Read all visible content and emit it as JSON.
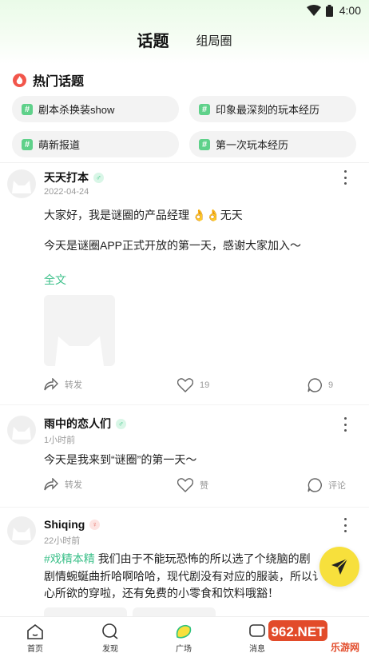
{
  "status_bar": {
    "time": "4:00",
    "icons": [
      "wifi-icon",
      "battery-icon"
    ]
  },
  "tabs": [
    {
      "label": "话题",
      "active": true
    },
    {
      "label": "组局圈",
      "active": false
    }
  ],
  "hot_topics": {
    "title": "热门话题",
    "icon": "fire-icon",
    "items": [
      {
        "label": "剧本杀换装show"
      },
      {
        "label": "印象最深刻的玩本经历"
      },
      {
        "label": "萌新报道"
      },
      {
        "label": "第一次玩本经历"
      }
    ]
  },
  "posts": [
    {
      "username": "天天打本",
      "gender": "♂",
      "time": "2022-04-24",
      "text_line1": "大家好，我是谜圈的产品经理 👌👌无天",
      "text_line2": "今天是谜圈APP正式开放的第一天，感谢大家加入～",
      "full_text": "全文",
      "forward_label": "转发",
      "likes": "19",
      "comments": "9"
    },
    {
      "username": "雨中的恋人们",
      "gender": "♂",
      "time": "1小时前",
      "text_line1": "今天是我来到“谜圈”的第一天～",
      "forward_label": "转发",
      "likes": "赞",
      "comments": "评论"
    },
    {
      "username": "Shiqing",
      "gender": "♀",
      "time": "22小时前",
      "tag": "#戏精本精",
      "text_line1": "我们由于不能玩恐怖的所以选了个绕脑的剧",
      "text_line2": "剧情蜿蜒曲折哈啊哈哈，现代剧没有对应的服装，所以讠",
      "text_line3": "心所欲的穿啦，还有免费的小零食和饮料哦豁！"
    }
  ],
  "bottom_nav": [
    {
      "label": "首页",
      "icon": "home-icon"
    },
    {
      "label": "发现",
      "icon": "discover-icon"
    },
    {
      "label": "广场",
      "icon": "square-icon",
      "active": true
    },
    {
      "label": "消息",
      "icon": "message-icon"
    }
  ],
  "watermark": {
    "text": "962.NET",
    "subtext": "乐游网"
  },
  "colors": {
    "accent_green": "#3cc08a",
    "accent_yellow": "#f7e03c",
    "fire": "#f2564b"
  }
}
